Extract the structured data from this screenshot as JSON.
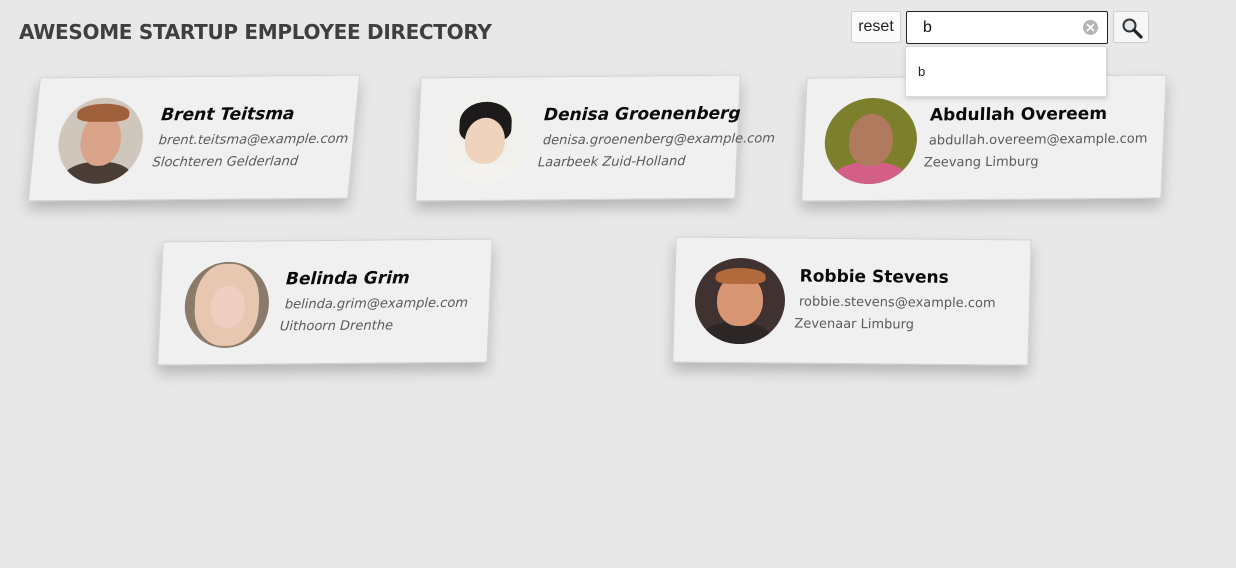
{
  "header": {
    "title": "AWESOME STARTUP EMPLOYEE DIRECTORY"
  },
  "toolbar": {
    "reset_label": "reset",
    "search_value": "b",
    "clear_icon": "clear-circle-icon",
    "search_icon": "magnifier-icon"
  },
  "autocomplete": {
    "items": [
      "b"
    ]
  },
  "employees": [
    {
      "name": "Brent Teitsma",
      "email": "brent.teitsma@example.com",
      "location": "Slochteren Gelderland"
    },
    {
      "name": "Denisa Groenenberg",
      "email": "denisa.groenenberg@example.com",
      "location": "Laarbeek Zuid-Holland"
    },
    {
      "name": "Abdullah Overeem",
      "email": "abdullah.overeem@example.com",
      "location": "Zeevang Limburg"
    },
    {
      "name": "Belinda Grim",
      "email": "belinda.grim@example.com",
      "location": "Uithoorn Drenthe"
    },
    {
      "name": "Robbie Stevens",
      "email": "robbie.stevens@example.com",
      "location": "Zevenaar Limburg"
    }
  ],
  "colors": {
    "background": "#e8e8e8",
    "card": "#f0f0f0",
    "title": "#3f3f3f"
  }
}
